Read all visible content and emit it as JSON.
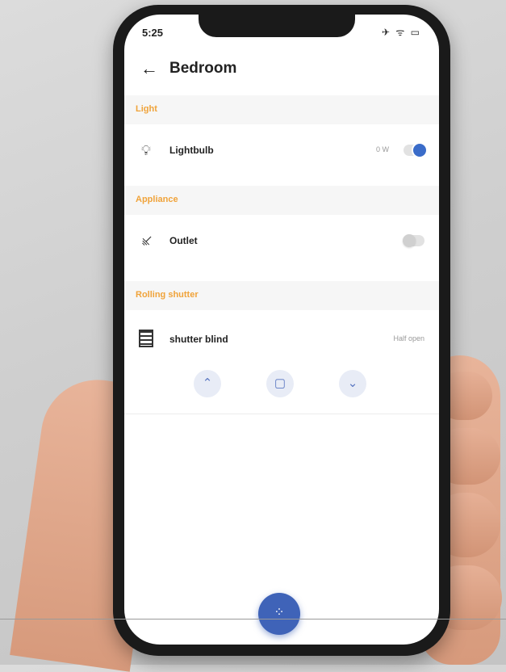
{
  "status_bar": {
    "time": "5:25",
    "icons": "✈ ᯤ ▭"
  },
  "header": {
    "back_icon": "←",
    "title": "Bedroom"
  },
  "sections": [
    {
      "label": "Light"
    },
    {
      "label": "Appliance"
    },
    {
      "label": "Rolling shutter"
    }
  ],
  "devices": {
    "lightbulb": {
      "label": "Lightbulb",
      "meta": "0 W",
      "on": true
    },
    "outlet": {
      "label": "Outlet",
      "on": false
    },
    "shutter": {
      "label": "shutter blind",
      "status": "Half open"
    }
  },
  "shutter_controls": {
    "up": "⌃",
    "stop": "▢",
    "down": "⌄"
  },
  "fab": {
    "icon": "⁘"
  },
  "colors": {
    "accent": "#3f63b8",
    "section_label": "#f0a33a"
  }
}
